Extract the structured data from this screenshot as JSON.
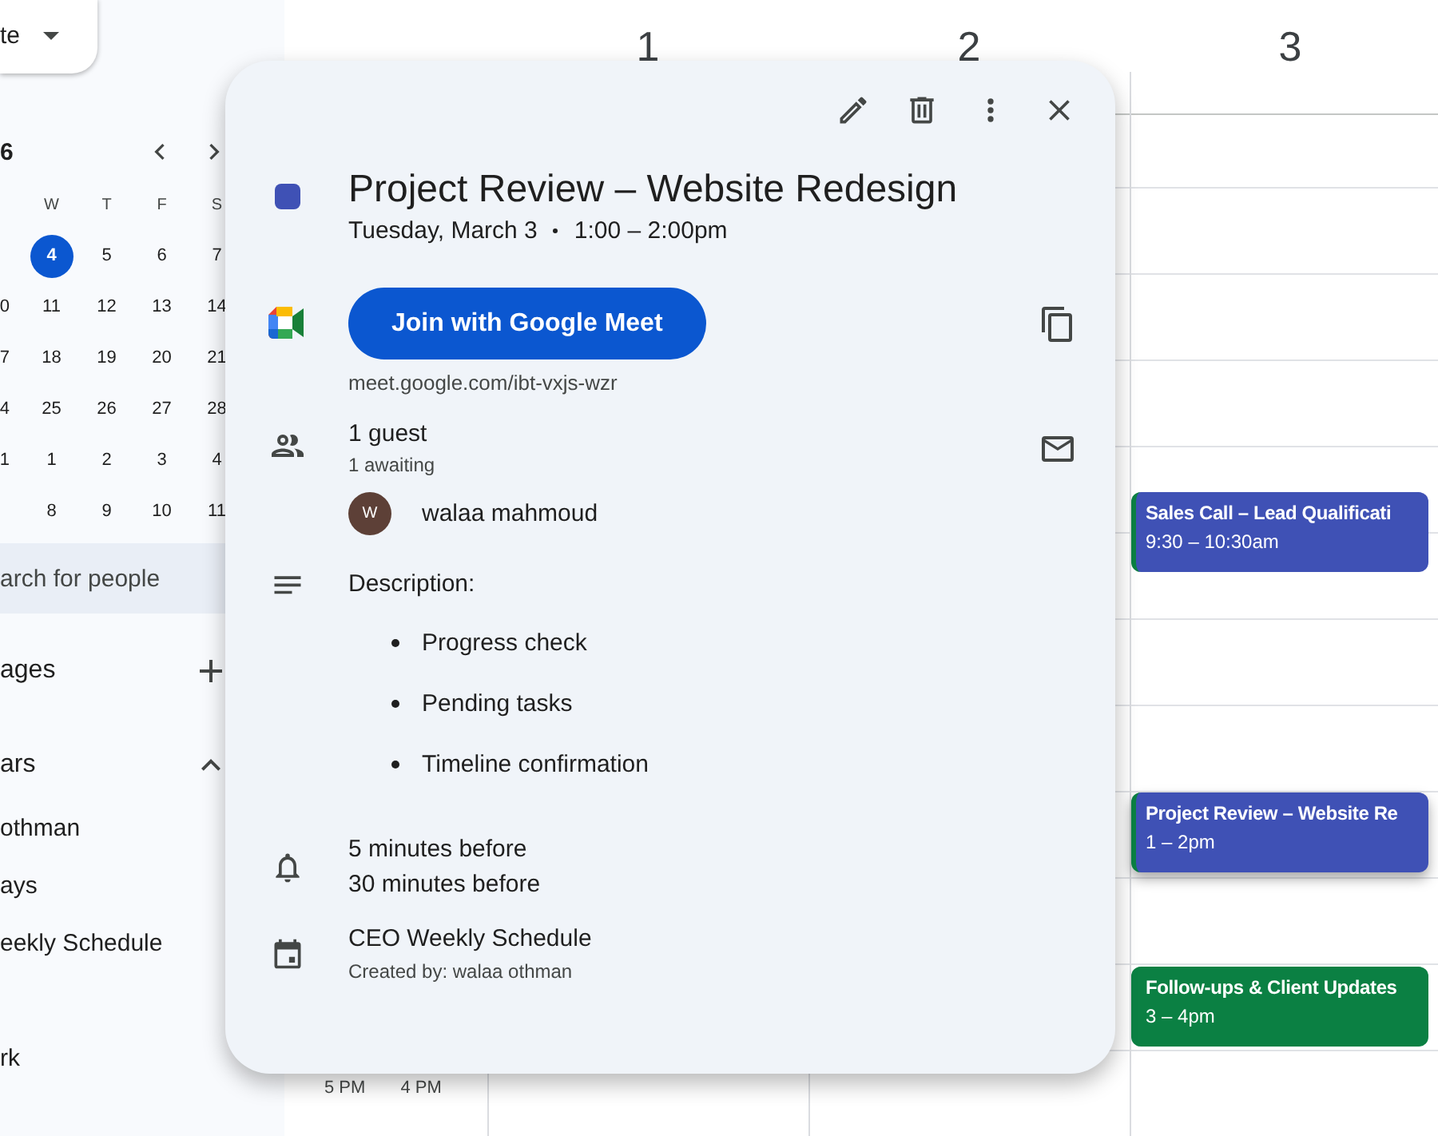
{
  "sidebar": {
    "create_button": {
      "label": "te"
    },
    "mini_calendar": {
      "month": "6",
      "weekdays": [
        "W",
        "T",
        "F",
        "S"
      ],
      "weeks": [
        {
          "days": [
            {
              "label": "4",
              "selected": true
            },
            {
              "label": "5",
              "selected": false
            },
            {
              "label": "6",
              "selected": false
            },
            {
              "label": "7",
              "selected": false
            }
          ]
        },
        {
          "cut": "0",
          "days": [
            {
              "label": "11",
              "selected": false
            },
            {
              "label": "12",
              "selected": false
            },
            {
              "label": "13",
              "selected": false
            },
            {
              "label": "14",
              "selected": false
            }
          ]
        },
        {
          "cut": "7",
          "days": [
            {
              "label": "18",
              "selected": false
            },
            {
              "label": "19",
              "selected": false
            },
            {
              "label": "20",
              "selected": false
            },
            {
              "label": "21",
              "selected": false
            }
          ]
        },
        {
          "cut": "4",
          "days": [
            {
              "label": "25",
              "selected": false
            },
            {
              "label": "26",
              "selected": false
            },
            {
              "label": "27",
              "selected": false
            },
            {
              "label": "28",
              "selected": false
            }
          ]
        },
        {
          "cut": "1",
          "days": [
            {
              "label": "1",
              "selected": false
            },
            {
              "label": "2",
              "selected": false
            },
            {
              "label": "3",
              "selected": false
            },
            {
              "label": "4",
              "selected": false
            }
          ]
        },
        {
          "days": [
            {
              "label": "8",
              "selected": false
            },
            {
              "label": "9",
              "selected": false
            },
            {
              "label": "10",
              "selected": false
            },
            {
              "label": "11",
              "selected": false
            }
          ]
        }
      ]
    },
    "people_search": {
      "placeholder": "arch for people"
    },
    "booking_pages": {
      "label": "ages"
    },
    "my_calendars": {
      "label": "ars",
      "expanded": true,
      "items": [
        "othman",
        "ays",
        "eekly Schedule",
        "rk"
      ]
    }
  },
  "calendar": {
    "days": [
      "1",
      "2",
      "3"
    ],
    "time_labels": [
      "5 PM",
      "4 PM"
    ],
    "events": [
      {
        "title": "Sales Call – Lead Qualificati",
        "time": "9:30 – 10:30am",
        "color": "#3f51b5"
      },
      {
        "title": "Project Review – Website Re",
        "time": "1 – 2pm",
        "color": "#3f51b5"
      },
      {
        "title": "Follow-ups & Client Updates",
        "time": "3 – 4pm",
        "color": "#0b8043"
      }
    ]
  },
  "event_popup": {
    "color": "#3f51b5",
    "title": "Project Review – Website Redesign",
    "date": "Tuesday, March 3",
    "time": "1:00 – 2:00pm",
    "meet_button": {
      "label": "Join with Google Meet"
    },
    "meet_link": "meet.google.com/ibt-vxjs-wzr",
    "guests": {
      "count": "1 guest",
      "status": "1 awaiting",
      "list": [
        {
          "initial": "W",
          "name": "walaa mahmoud"
        }
      ]
    },
    "description": {
      "heading": "Description:",
      "bullets": [
        "Progress check",
        "Pending tasks",
        "Timeline confirmation"
      ]
    },
    "reminders": [
      "5 minutes before",
      "30 minutes before"
    ],
    "calendar": {
      "name": "CEO Weekly Schedule",
      "creator": "Created by: walaa othman"
    }
  }
}
